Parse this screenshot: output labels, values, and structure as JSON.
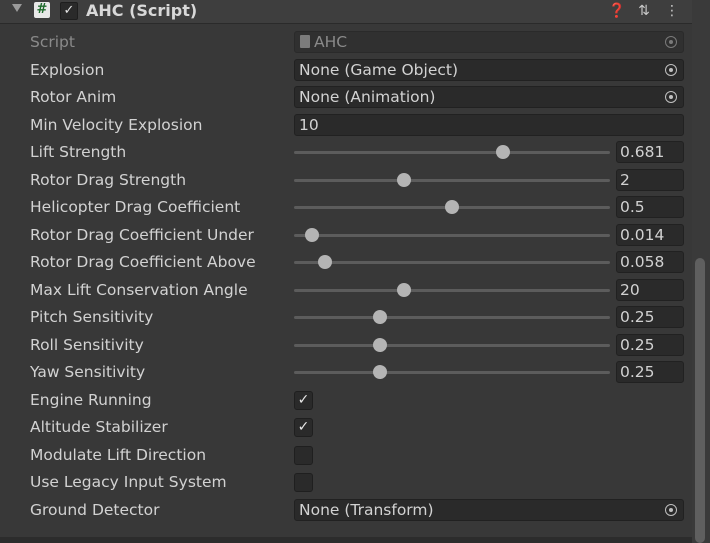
{
  "component": {
    "title": "AHC (Script)",
    "enabled_glyph": "✓",
    "script_glyph": "#",
    "header_icons": [
      "help-icon",
      "preset-icon",
      "more-options-icon"
    ]
  },
  "script_row": {
    "label": "Script",
    "value": "AHC"
  },
  "object_fields": [
    {
      "label": "Explosion",
      "value": "None (Game Object)"
    },
    {
      "label": "Rotor Anim",
      "value": "None (Animation)"
    }
  ],
  "min_velocity": {
    "label": "Min Velocity Explosion",
    "value": "10"
  },
  "sliders": [
    {
      "label": "Lift Strength",
      "value": "0.681",
      "fraction": 0.67
    },
    {
      "label": "Rotor Drag Strength",
      "value": "2",
      "fraction": 0.34
    },
    {
      "label": "Helicopter Drag Coefficient",
      "value": "0.5",
      "fraction": 0.5
    },
    {
      "label": "Rotor Drag Coefficient Under",
      "value": "0.014",
      "fraction": 0.035
    },
    {
      "label": "Rotor Drag Coefficient Above",
      "value": "0.058",
      "fraction": 0.08
    },
    {
      "label": "Max Lift Conservation Angle",
      "value": "20",
      "fraction": 0.34
    },
    {
      "label": "Pitch Sensitivity",
      "value": "0.25",
      "fraction": 0.26
    },
    {
      "label": "Roll Sensitivity",
      "value": "0.25",
      "fraction": 0.26
    },
    {
      "label": "Yaw Sensitivity",
      "value": "0.25",
      "fraction": 0.26
    }
  ],
  "toggles": [
    {
      "label": "Engine Running",
      "checked": true
    },
    {
      "label": "Altitude Stabilizer",
      "checked": true
    },
    {
      "label": "Modulate Lift Direction",
      "checked": false
    },
    {
      "label": "Use Legacy Input System",
      "checked": false
    }
  ],
  "ground_detector": {
    "label": "Ground Detector",
    "value": "None (Transform)"
  },
  "check_glyph": "✓"
}
